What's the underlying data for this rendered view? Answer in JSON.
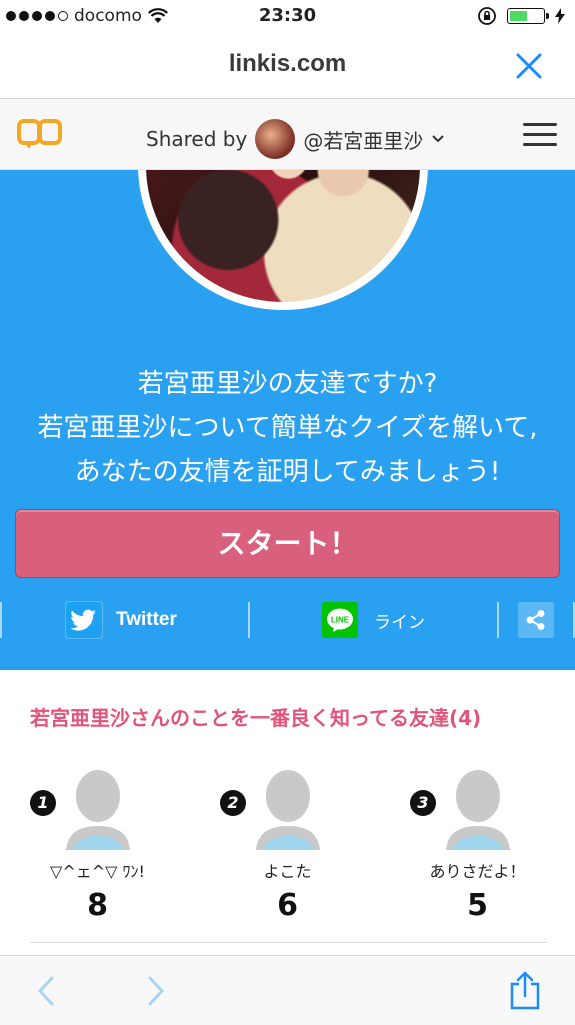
{
  "status_bar": {
    "carrier": "docomo",
    "time": "23:30",
    "battery_level": 0.55
  },
  "url_bar": {
    "domain": "linkis.com"
  },
  "share_header": {
    "shared_by_label": "Shared by",
    "username": "@若宮亜里沙"
  },
  "hero": {
    "line1": "若宮亜里沙の友達ですか?",
    "line2": "若宮亜里沙について簡単なクイズを解いて,",
    "line3": "あなたの友情を証明してみましょう!",
    "start_label": "スタート！",
    "share": {
      "twitter_label": "Twitter",
      "line_label": "ライン",
      "line_icon_text": "LINE"
    }
  },
  "friends": {
    "title": "若宮亜里沙さんのことを一番良く知ってる友達(4)",
    "items": [
      {
        "rank": "1",
        "name": "▽^ェ^▽ ﾜﾝ!",
        "score": "8"
      },
      {
        "rank": "2",
        "name": "よこた",
        "score": "6"
      },
      {
        "rank": "3",
        "name": "ありさだよ！",
        "score": "5"
      }
    ]
  },
  "colors": {
    "hero_bg": "#2aa0f0",
    "start_button": "#d9607d",
    "accent_pink": "#e0547a",
    "ios_blue": "#1a8cff"
  }
}
